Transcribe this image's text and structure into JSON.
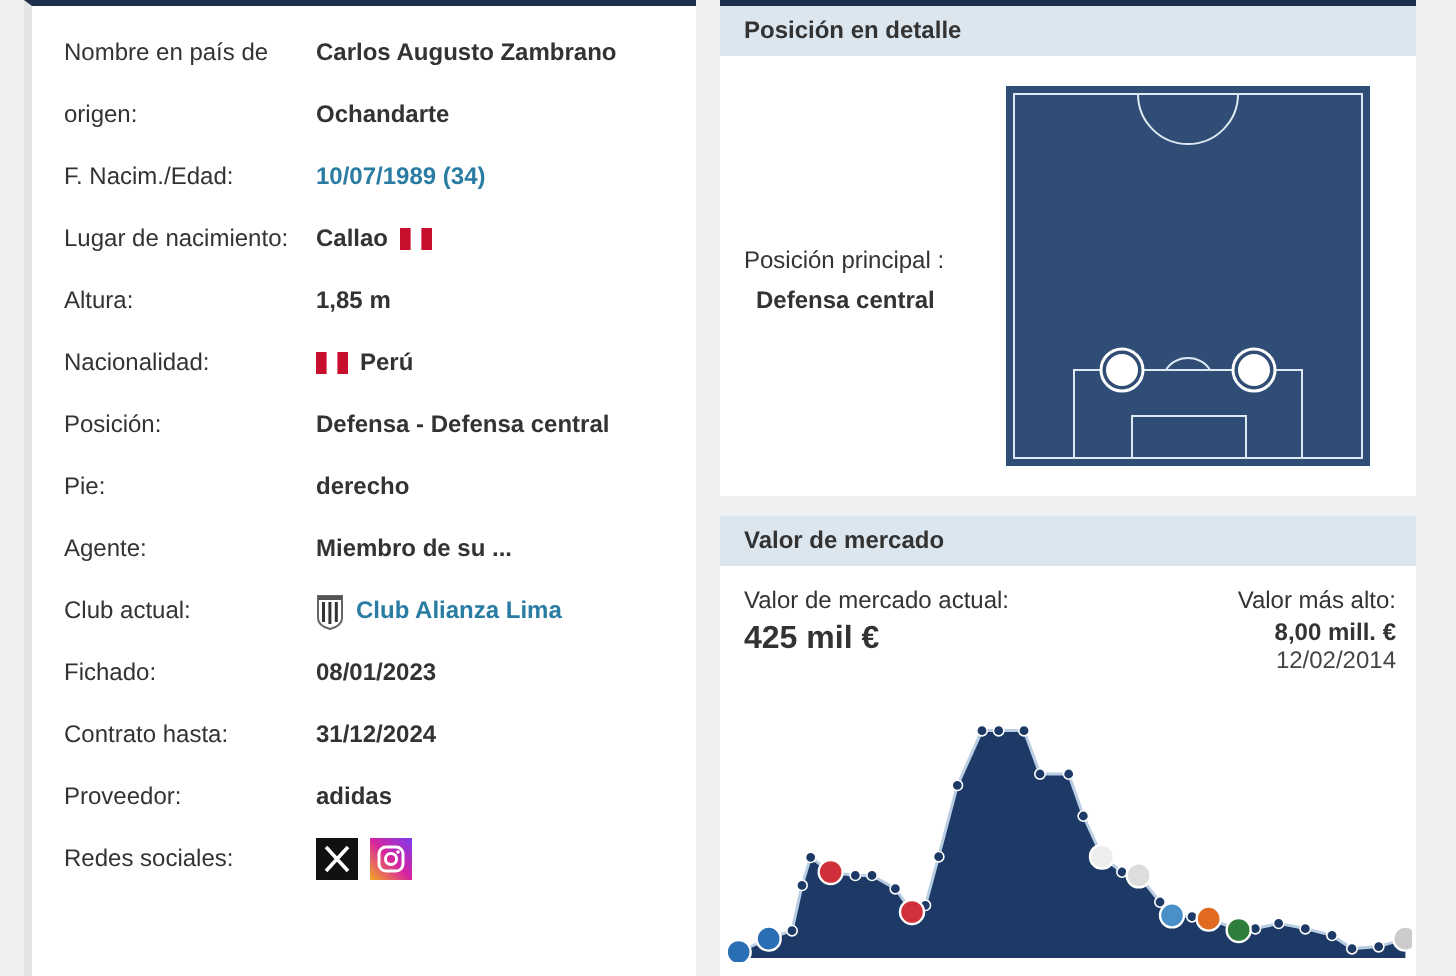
{
  "profile": {
    "rows": [
      {
        "label": "Nombre en país de origen:",
        "value": "Carlos Augusto Zambrano Ochandarte",
        "kind": "text"
      },
      {
        "label": "F. Nacim./Edad:",
        "value": "10/07/1989 (34)",
        "kind": "link"
      },
      {
        "label": "Lugar de nacimiento:",
        "value": "Callao",
        "kind": "flag_after"
      },
      {
        "label": "Altura:",
        "value": "1,85 m",
        "kind": "text"
      },
      {
        "label": "Nacionalidad:",
        "value": "Perú",
        "kind": "flag_before"
      },
      {
        "label": "Posición:",
        "value": "Defensa - Defensa central",
        "kind": "text"
      },
      {
        "label": "Pie:",
        "value": "derecho",
        "kind": "text"
      },
      {
        "label": "Agente:",
        "value": "Miembro de su ...",
        "kind": "text"
      },
      {
        "label": "Club actual:",
        "value": "Club Alianza Lima",
        "kind": "club"
      },
      {
        "label": "Fichado:",
        "value": "08/01/2023",
        "kind": "text"
      },
      {
        "label": "Contrato hasta:",
        "value": "31/12/2024",
        "kind": "text"
      },
      {
        "label": "Proveedor:",
        "value": "adidas",
        "kind": "text"
      },
      {
        "label": "Redes sociales:",
        "kind": "social"
      }
    ]
  },
  "position": {
    "title": "Posición en detalle",
    "label": "Posición principal :",
    "value": "Defensa central"
  },
  "market": {
    "title": "Valor de mercado",
    "current_label": "Valor de mercado actual:",
    "current_value": "425 mil €",
    "highest_label": "Valor más alto:",
    "highest_value": "8,00 mill. €",
    "highest_date": "12/02/2014"
  }
}
